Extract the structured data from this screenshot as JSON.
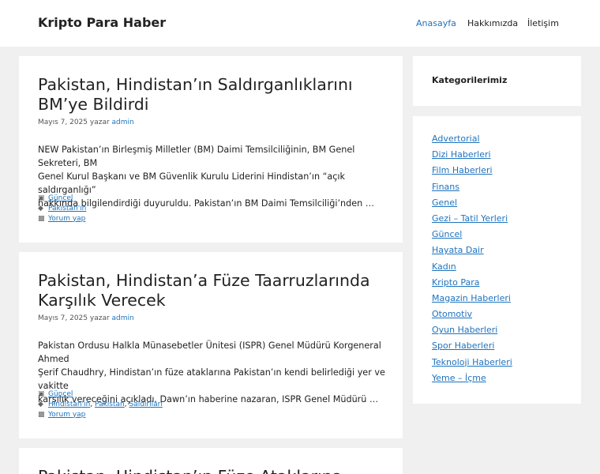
{
  "site": {
    "title": "Kripto Para Haber"
  },
  "nav": [
    "Anasayfa",
    "Hakkımızda",
    "İletişim"
  ],
  "posts": [
    {
      "title_lines": [
        "Pakistan, Hindistan’ın Saldırganlıklarını",
        "BM’ye Bildirdi"
      ],
      "date": "Mayıs 7, 2025",
      "by": "yazar",
      "author": "admin",
      "excerpt_lines": [
        "NEW Pakistan’ın Birleşmiş Milletler (BM) Daimi Temsilciliğinin, BM Genel Sekreteri, BM",
        "Genel Kurul Başkanı ve BM Güvenlik Kurulu Liderini Hindistan’ın “açık saldırganlığı”",
        "hakkında bilgilendirdiği duyuruldu. Pakistan’ın BM Daimi Temsilciliği’nden …"
      ],
      "category": "Güncel",
      "tags": [
        "Pakistan'ın"
      ],
      "comment": "Yorum yap"
    },
    {
      "title_lines": [
        "Pakistan, Hindistan’a Füze Taarruzlarında",
        "Karşılık Verecek"
      ],
      "date": "Mayıs 7, 2025",
      "by": "yazar",
      "author": "admin",
      "excerpt_lines": [
        "Pakistan Ordusu Halkla Münasebetler Ünitesi (ISPR) Genel Müdürü Korgeneral Ahmed",
        "Şerif Chaudhry, Hindistan’ın füze ataklarına Pakistan’ın kendi belirlediği yer ve vakitte",
        "karşılık vereceğini açıkladı. Dawn’ın haberine nazaran, ISPR Genel Müdürü …"
      ],
      "category": "Güncel",
      "tags": [
        "Hindistan'ın",
        "Pakistan",
        "Saldırıları"
      ],
      "comment": "Yorum yap"
    },
    {
      "title_lines": [
        "Pakistan, Hindistan’ın Füze Ataklarına"
      ]
    }
  ],
  "sidebar": {
    "widget_title": "Kategorilerimiz",
    "categories": [
      "Advertorial",
      "Dizi Haberleri",
      "Film Haberleri",
      "Finans",
      "Genel",
      "Gezi – Tatil Yerleri",
      "Güncel",
      "Hayata Dair",
      "Kadın",
      "Kripto Para",
      "Magazin Haberleri",
      "Otomotiv",
      "Oyun Haberleri",
      "Spor Haberleri",
      "Teknoloji Haberleri",
      "Yeme – İçme"
    ]
  },
  "icons": {
    "category": "folder-icon",
    "tag": "tag-icon",
    "comment": "comments-icon"
  },
  "colors": {
    "link": "#1e73be",
    "background": "#f0f0f0",
    "text": "#222222"
  }
}
